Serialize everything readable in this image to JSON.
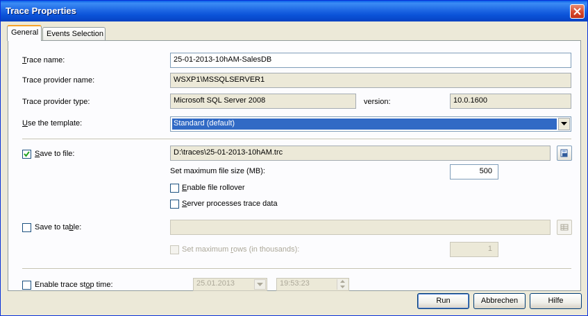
{
  "window": {
    "title": "Trace Properties"
  },
  "tabs": [
    {
      "label": "General",
      "active": true
    },
    {
      "label": "Events Selection",
      "active": false
    }
  ],
  "general": {
    "trace_name": {
      "label": "Trace name:",
      "value": "25-01-2013-10hAM-SalesDB"
    },
    "provider_name": {
      "label": "Trace provider name:",
      "value": "WSXP1\\MSSQLSERVER1"
    },
    "provider_type": {
      "label": "Trace provider type:",
      "value": "Microsoft SQL Server 2008"
    },
    "version": {
      "label": "version:",
      "value": "10.0.1600"
    },
    "template": {
      "label": "Use the template:",
      "value": "Standard (default)"
    },
    "save_to_file": {
      "label": "Save to file:",
      "checked": true,
      "path": "D:\\traces\\25-01-2013-10hAM.trc",
      "max_size_label": "Set maximum file size (MB):",
      "max_size": "500",
      "rollover_label": "Enable file rollover",
      "rollover_checked": false,
      "server_processes_label": "Server processes trace data",
      "server_processes_checked": false
    },
    "save_to_table": {
      "label": "Save to table:",
      "checked": false,
      "value": "",
      "max_rows_label": "Set maximum rows (in thousands):",
      "max_rows": "1"
    },
    "stop_time": {
      "label": "Enable trace stop time:",
      "checked": false,
      "date": "25.01.2013",
      "time": "19:53:23"
    }
  },
  "buttons": {
    "run": "Run",
    "cancel": "Abbrechen",
    "help": "Hilfe"
  }
}
